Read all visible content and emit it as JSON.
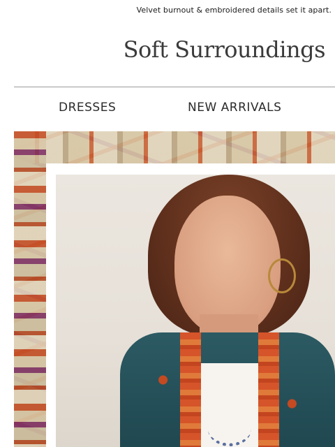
{
  "preheader": "Velvet burnout & embroidered details set it apart.",
  "brand": {
    "logo_text": "Soft Surroundings"
  },
  "nav": [
    {
      "label": "DRESSES"
    },
    {
      "label": "NEW ARRIVALS"
    }
  ],
  "hero": {
    "image_description": "model-in-embroidered-kimono-jacket",
    "colors": {
      "jacket": "#2c5a63",
      "trim": "#d6542a",
      "background": "#ebe6df"
    }
  }
}
